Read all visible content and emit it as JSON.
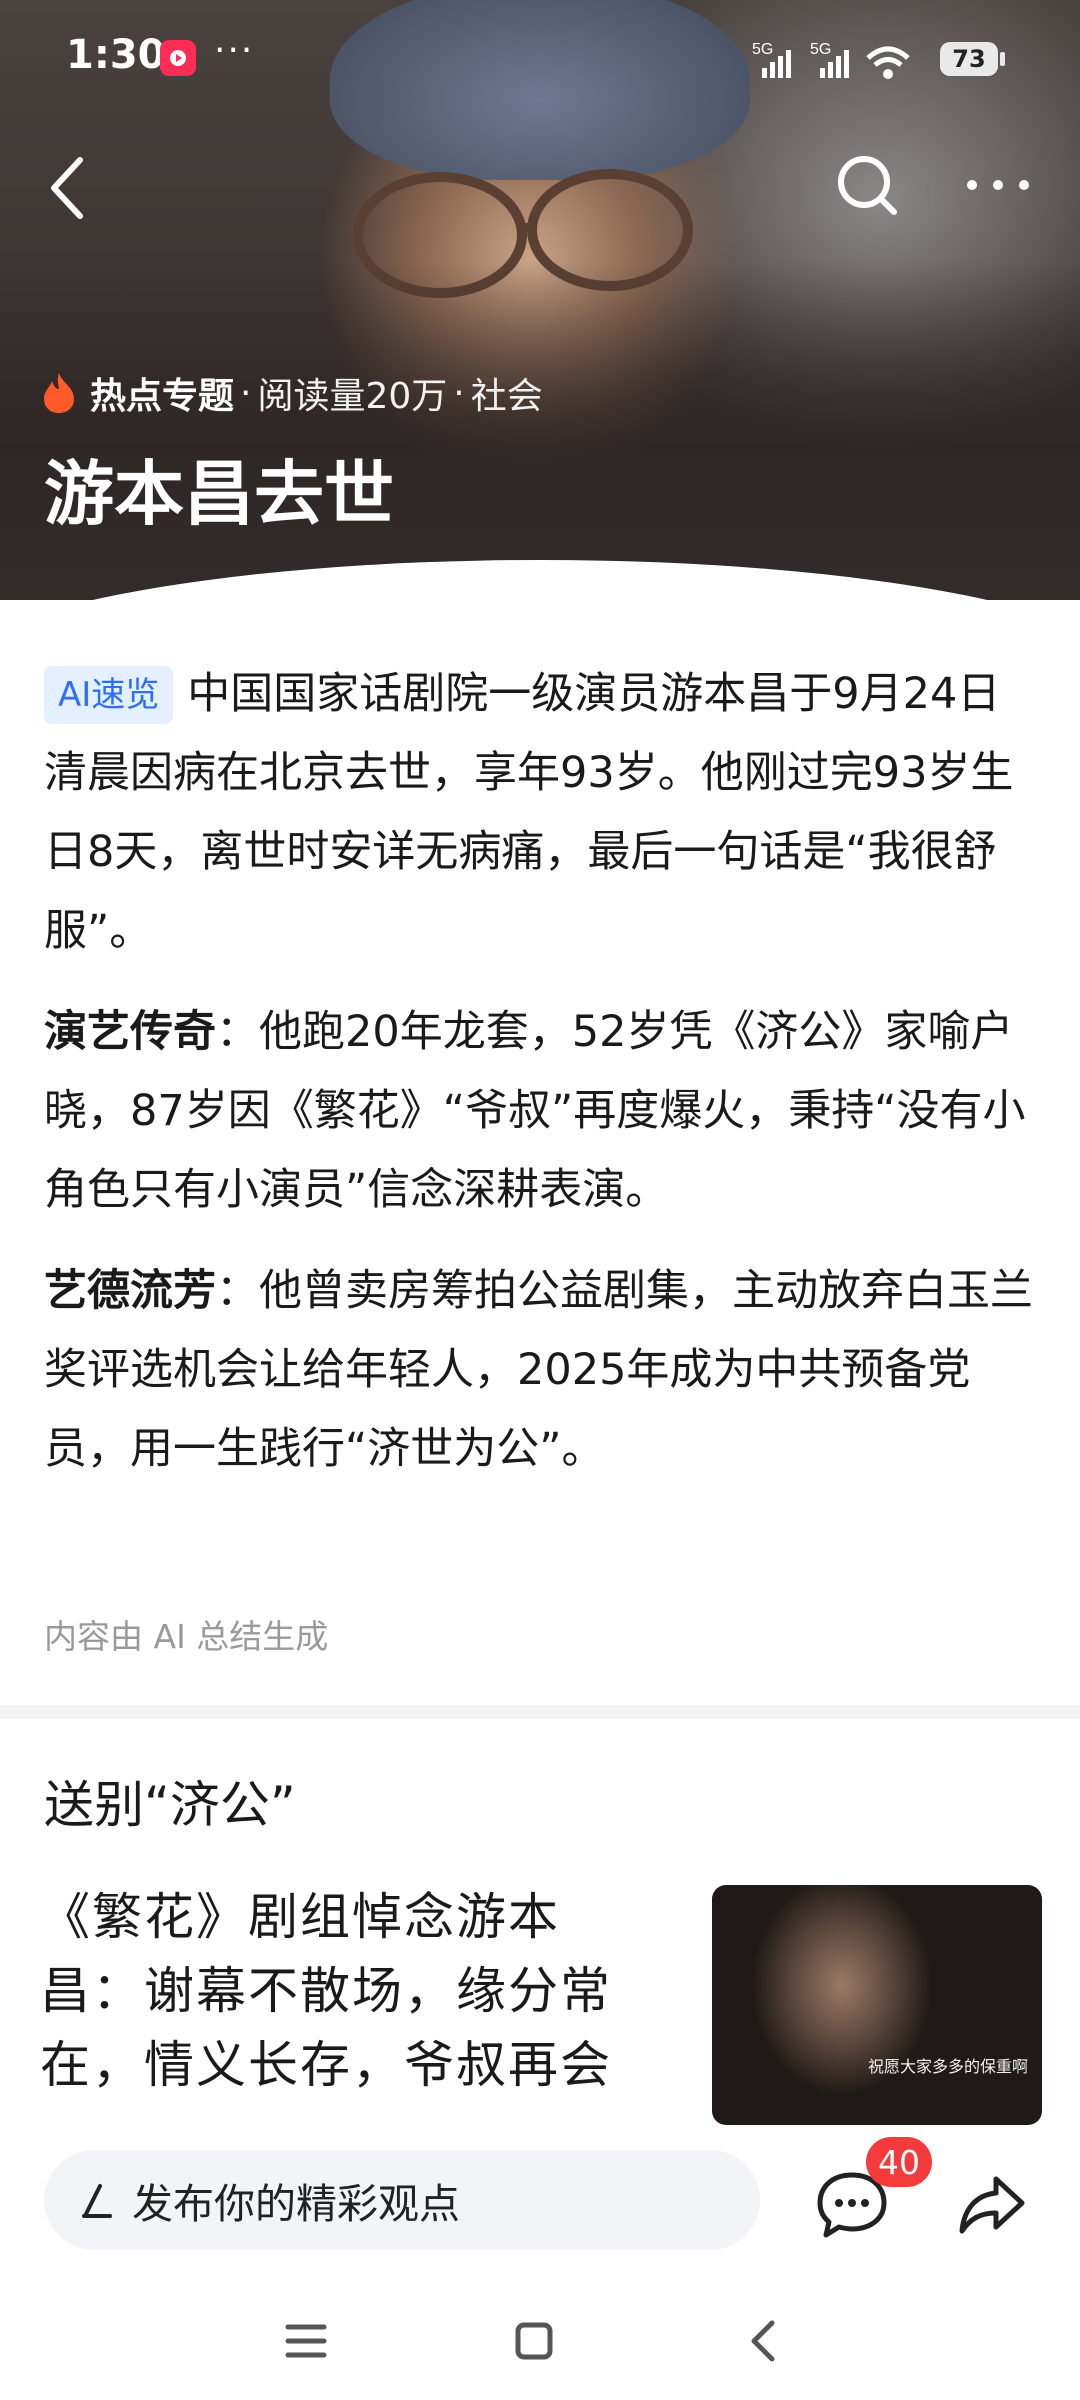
{
  "status_bar": {
    "time": "1:30",
    "more": "···",
    "signal_1": "5G",
    "signal_2": "5G",
    "battery": "73"
  },
  "nav": {
    "back_icon": "chevron-left-icon",
    "search_icon": "search-icon",
    "more_icon": "more-horizontal-icon"
  },
  "hero": {
    "topic": "热点专题",
    "meta_reads": "阅读量20万",
    "meta_category": "社会",
    "separator": "·",
    "title": "游本昌去世"
  },
  "summary": {
    "badge": "AI速览",
    "intro": "中国国家话剧院一级演员游本昌于9月24日清晨因病在北京去世，享年93岁。他刚过完93岁生日8天，离世时安详无病痛，最后一句话是“我很舒服”。",
    "section1_label": "演艺传奇",
    "section1_text": "：他跑20年龙套，52岁凭《济公》家喻户晓，87岁因《繁花》“爷叔”再度爆火，秉持“没有小角色只有小演员”信念深耕表演。",
    "section2_label": "艺德流芳",
    "section2_text": "：他曾卖房筹拍公益剧集，主动放弃白玉兰奖评选机会让给年轻人，2025年成为中共预备党员，用一生践行“济世为公”。",
    "note": "内容由 AI 总结生成"
  },
  "related": {
    "section_title": "送别“济公”",
    "article_title": "《繁花》剧组悼念游本昌：谢幕不散场，缘分常在，情义长存，爷叔再会",
    "thumb_caption": "祝愿大家多多的保重啊"
  },
  "bottom_bar": {
    "comment_placeholder": "发布你的精彩观点",
    "comment_count": "40"
  },
  "colors": {
    "accent_blue": "#2f6ff5",
    "badge_red": "#f43b3b",
    "fire_orange": "#ff5a2a"
  }
}
